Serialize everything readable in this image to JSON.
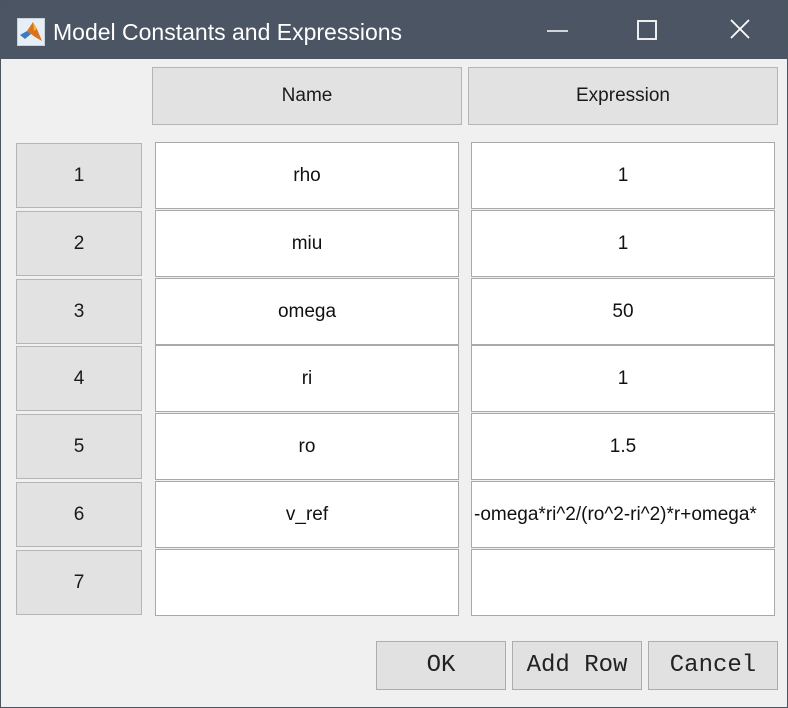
{
  "window": {
    "title": "Model Constants and Expressions",
    "colors": {
      "titlebar": "#4b5563",
      "title_text": "#ffffff"
    },
    "icons": {
      "app": "matlab-logo-icon",
      "minimize": "minimize-icon",
      "maximize": "maximize-icon",
      "close": "close-icon"
    }
  },
  "table": {
    "columns": [
      "Name",
      "Expression"
    ],
    "rows": [
      {
        "index": "1",
        "name": "rho",
        "expression": "1"
      },
      {
        "index": "2",
        "name": "miu",
        "expression": "1"
      },
      {
        "index": "3",
        "name": "omega",
        "expression": "50"
      },
      {
        "index": "4",
        "name": "ri",
        "expression": "1"
      },
      {
        "index": "5",
        "name": "ro",
        "expression": "1.5"
      },
      {
        "index": "6",
        "name": "v_ref",
        "expression": "-omega*ri^2/(ro^2-ri^2)*r+omega*"
      },
      {
        "index": "7",
        "name": "",
        "expression": ""
      }
    ]
  },
  "buttons": {
    "ok": "OK",
    "add_row": "Add Row",
    "cancel": "Cancel"
  }
}
